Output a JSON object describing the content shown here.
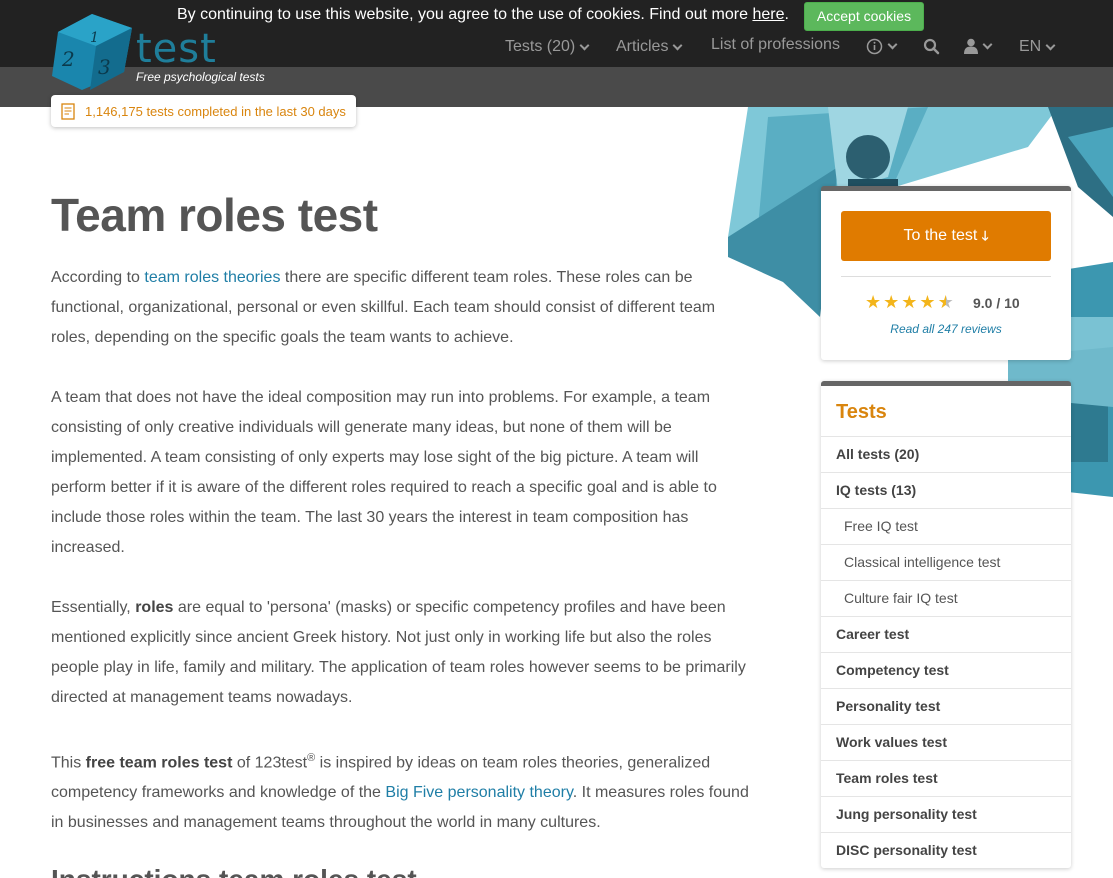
{
  "header": {
    "logo_text": "test",
    "logo_tagline": "Free psychological tests",
    "cookie_text": "By continuing to use this website, you agree to the use of cookies. Find out more ",
    "cookie_link": "here",
    "cookie_period": ".",
    "accept_cookies": "Accept cookies",
    "nav": {
      "tests": "Tests (20)",
      "articles": "Articles",
      "professions": "List of professions",
      "language": "EN"
    },
    "counter": "1,146,175 tests completed in the last 30 days"
  },
  "main": {
    "title": "Team roles test",
    "p1": {
      "a": "According to ",
      "link": "team roles theories",
      "b": " there are specific different team roles. These roles can be functional, organizational, personal or even skillful. Each team should consist of different team roles, depending on the specific goals the team wants to achieve."
    },
    "p2": "A team that does not have the ideal composition may run into problems. For example, a team consisting of only creative individuals will generate many ideas, but none of them will be implemented. A team consisting of only experts may lose sight of the big picture. A team will perform better if it is aware of the different roles required to reach a specific goal and is able to include those roles within the team. The last 30 years the interest in team composition has increased.",
    "p3": {
      "a": "Essentially, ",
      "bold": "roles",
      "b": " are equal to 'persona' (masks) or specific competency profiles and have been mentioned explicitly since ancient Greek history. Not just only in working life but also the roles people play in life, family and military. The application of team roles however seems to be primarily directed at management teams nowadays."
    },
    "p4": {
      "a": "This ",
      "bold": "free team roles test",
      "b": " of 123test",
      "sup": "®",
      "c": " is inspired by ideas on team roles theories, generalized competency frameworks and knowledge of the ",
      "link": "Big Five personality theory",
      "d": ". It measures roles found in businesses and management teams throughout the world in many cultures."
    },
    "h2": "Instructions team roles test"
  },
  "rating_card": {
    "cta": "To the test",
    "cta_arrow": "🡓",
    "rating": 4.5,
    "score": "9.0 / 10",
    "reviews": "Read all 247 reviews"
  },
  "tests_card": {
    "title": "Tests",
    "items": [
      {
        "label": "All tests (20)"
      },
      {
        "label": "IQ tests (13)"
      },
      {
        "label": "Free IQ test"
      },
      {
        "label": "Classical intelligence test"
      },
      {
        "label": "Culture fair IQ test"
      },
      {
        "label": "Career test"
      },
      {
        "label": "Competency test"
      },
      {
        "label": "Personality test"
      },
      {
        "label": "Work values test"
      },
      {
        "label": "Team roles test"
      },
      {
        "label": "Jung personality test"
      },
      {
        "label": "DISC personality test"
      }
    ]
  },
  "colors": {
    "accent_orange": "#e07b00",
    "link_blue": "#1f7ea6",
    "accept_green": "#5cb85c",
    "header_dark": "#222222"
  }
}
